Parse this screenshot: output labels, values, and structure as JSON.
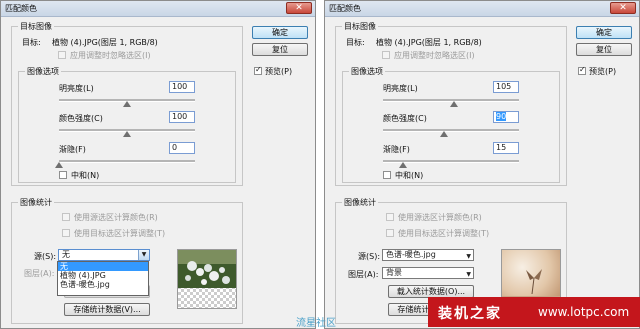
{
  "watermarks": {
    "bottom_center": "流星社区",
    "corner_cn": "装机之家",
    "corner_url": "www.lotpc.com"
  },
  "left": {
    "title": "匹配颜色",
    "buttons": {
      "ok": "确定",
      "reset": "复位",
      "preview": "预览(P)"
    },
    "target": {
      "group": "目标图像",
      "label": "目标:",
      "value": "植物 (4).JPG(图层 1, RGB/8)",
      "ignore_selection": "应用调整时忽略选区(I)"
    },
    "options": {
      "group": "图像选项",
      "luminance": {
        "label": "明亮度(L)",
        "value": "100",
        "level": 0.5
      },
      "intensity": {
        "label": "颜色强度(C)",
        "value": "100",
        "level": 0.5
      },
      "fade": {
        "label": "渐隐(F)",
        "value": "0",
        "level": 0.0
      },
      "neutralize": "中和(N)"
    },
    "stats": {
      "group": "图像统计",
      "use_source_selection": "使用源选区计算颜色(R)",
      "use_target_selection": "使用目标选区计算调整(T)",
      "source_label": "源(S):",
      "source_value": "无",
      "layer_label": "图层(A):",
      "load_button": "载入统计数据(O)...",
      "save_button": "存储统计数据(V)...",
      "dropdown_options": [
        "无",
        "植物 (4).JPG",
        "色谱-暖色.jpg"
      ]
    }
  },
  "right": {
    "title": "匹配颜色",
    "buttons": {
      "ok": "确定",
      "reset": "复位",
      "preview": "预览(P)"
    },
    "target": {
      "group": "目标图像",
      "label": "目标:",
      "value": "植物 (4).JPG(图层 1, RGB/8)",
      "ignore_selection": "应用调整时忽略选区(I)"
    },
    "options": {
      "group": "图像选项",
      "luminance": {
        "label": "明亮度(L)",
        "value": "105",
        "level": 0.52
      },
      "intensity": {
        "label": "颜色强度(C)",
        "value": "90",
        "level": 0.45
      },
      "fade": {
        "label": "渐隐(F)",
        "value": "15",
        "level": 0.15
      },
      "neutralize": "中和(N)"
    },
    "stats": {
      "group": "图像统计",
      "use_source_selection": "使用源选区计算颜色(R)",
      "use_target_selection": "使用目标选区计算调整(T)",
      "source_label": "源(S):",
      "source_value": "色谱-暖色.jpg",
      "layer_label": "图层(A):",
      "layer_value": "背景",
      "load_button": "载入统计数据(O)...",
      "save_button": "存储统计数据(V)..."
    }
  }
}
